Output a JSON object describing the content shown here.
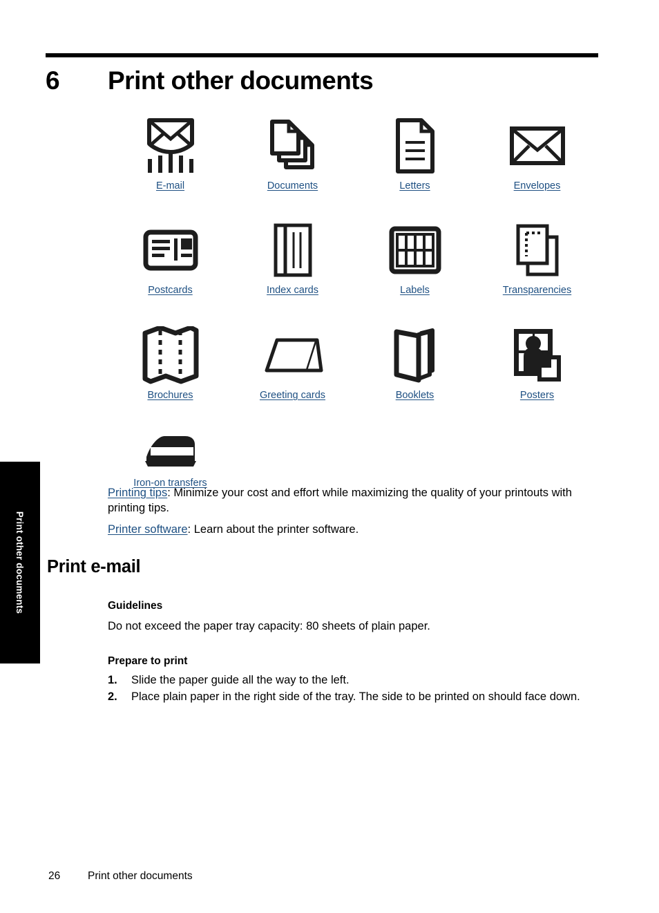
{
  "chapter": {
    "number": "6",
    "title": "Print other documents"
  },
  "icon_grid": {
    "rows": [
      [
        {
          "label": "E-mail",
          "icon": "email-envelope-icon"
        },
        {
          "label": "Documents",
          "icon": "documents-stack-icon"
        },
        {
          "label": "Letters",
          "icon": "letter-page-icon"
        },
        {
          "label": "Envelopes",
          "icon": "envelope-icon"
        }
      ],
      [
        {
          "label": "Postcards",
          "icon": "postcard-icon"
        },
        {
          "label": "Index cards",
          "icon": "index-card-icon"
        },
        {
          "label": "Labels",
          "icon": "labels-grid-icon"
        },
        {
          "label": "Transparencies",
          "icon": "transparency-sheets-icon"
        }
      ],
      [
        {
          "label": "Brochures",
          "icon": "brochure-fold-icon"
        },
        {
          "label": "Greeting cards",
          "icon": "greeting-card-icon"
        },
        {
          "label": "Booklets",
          "icon": "booklet-book-icon"
        },
        {
          "label": "Posters",
          "icon": "poster-tiles-icon"
        }
      ],
      [
        {
          "label": "Iron-on transfers",
          "icon": "iron-icon"
        }
      ]
    ]
  },
  "paragraphs": {
    "printing_tips_link": "Printing tips",
    "printing_tips_text": ": Minimize your cost and effort while maximizing the quality of your printouts with printing tips.",
    "printer_software_link": "Printer software",
    "printer_software_text": ": Learn about the printer software."
  },
  "section": {
    "heading": "Print e-mail",
    "guidelines_heading": "Guidelines",
    "guidelines_body": "Do not exceed the paper tray capacity: 80 sheets of plain paper.",
    "prepare_heading": "Prepare to print",
    "steps": [
      {
        "num": "1.",
        "text": "Slide the paper guide all the way to the left."
      },
      {
        "num": "2.",
        "text": "Place plain paper in the right side of the tray. The side to be printed on should face down."
      }
    ]
  },
  "side_tab": {
    "label": "Print other documents"
  },
  "footer": {
    "page_number": "26",
    "chapter_name": "Print other documents"
  },
  "colors": {
    "link": "#1d4f82",
    "ink": "#1d1d1d",
    "text": "#000000"
  }
}
